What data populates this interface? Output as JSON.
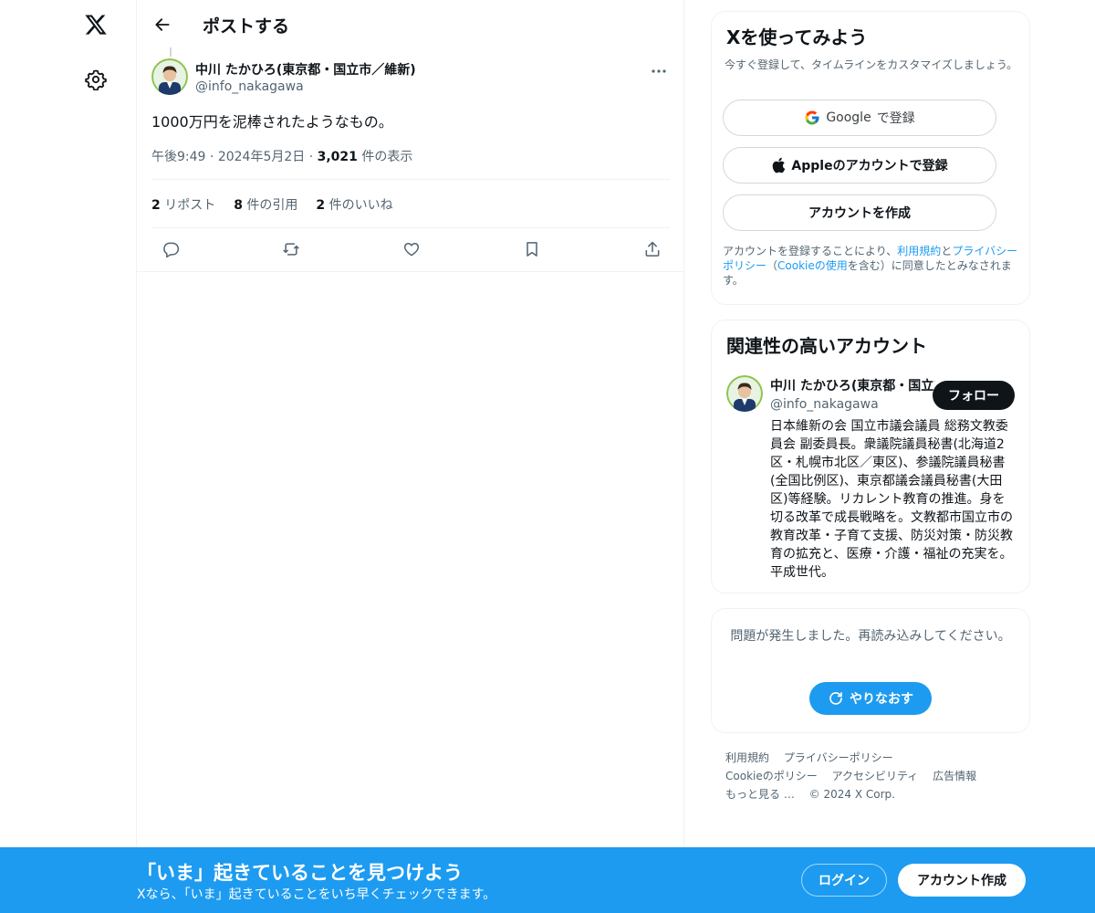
{
  "colors": {
    "accent": "#1d9bf0",
    "text": "#0f1419",
    "muted": "#536471"
  },
  "nav": {
    "logo_icon": "x-logo-icon",
    "settings_icon": "gear-icon"
  },
  "header": {
    "title": "ポストする"
  },
  "post": {
    "author_name": "中川 たかひろ(東京都・国立市／維新)",
    "author_handle": "@info_nakagawa",
    "text": "1000万円を泥棒されたようなもの。",
    "time": "午後9:49",
    "date": "2024年5月2日",
    "views_count": "3,021",
    "views_label": "件の表示",
    "stats": [
      {
        "count": "2",
        "label": "リポスト"
      },
      {
        "count": "8",
        "label": "件の引用"
      },
      {
        "count": "2",
        "label": "件のいいね"
      }
    ]
  },
  "signup_card": {
    "title": "Xを使ってみよう",
    "subtitle": "今すぐ登録して、タイムラインをカスタマイズしましょう。",
    "google_brand": "Google",
    "google_suffix": "で登録",
    "apple_label": "Appleのアカウントで登録",
    "create_label": "アカウントを作成",
    "legal_1": "アカウントを登録することにより、",
    "legal_link_terms": "利用規約",
    "legal_2": "と",
    "legal_link_privacy": "プライバシーポリシー",
    "legal_3": "（",
    "legal_link_cookie": "Cookieの使用",
    "legal_4": "を含む）に同意したとみなされます。"
  },
  "related": {
    "title": "関連性の高いアカウント",
    "name": "中川 たかひろ(東京都・国立市／維新)",
    "handle": "@info_nakagawa",
    "follow_label": "フォロー",
    "bio": "日本維新の会 国立市議会議員 総務文教委員会 副委員長。衆議院議員秘書(北海道2区・札幌市北区／東区)、参議院議員秘書(全国比例区)、東京都議会議員秘書(大田区)等経験。リカレント教育の推進。身を切る改革で成長戦略を。文教都市国立市の教育改革・子育て支援、防災対策・防災教育の拡充と、医療・介護・福祉の充実を。平成世代。"
  },
  "error_card": {
    "message": "問題が発生しました。再読み込みしてください。",
    "retry_label": "やりなおす"
  },
  "footer": {
    "links": [
      "利用規約",
      "プライバシーポリシー",
      "Cookieのポリシー",
      "アクセシビリティ",
      "広告情報",
      "もっと見る …",
      "© 2024 X Corp."
    ]
  },
  "banner": {
    "title": "「いま」起きていることを見つけよう",
    "subtitle": "Xなら、「いま」起きていることをいち早くチェックできます。",
    "login_label": "ログイン",
    "signup_label": "アカウント作成"
  }
}
